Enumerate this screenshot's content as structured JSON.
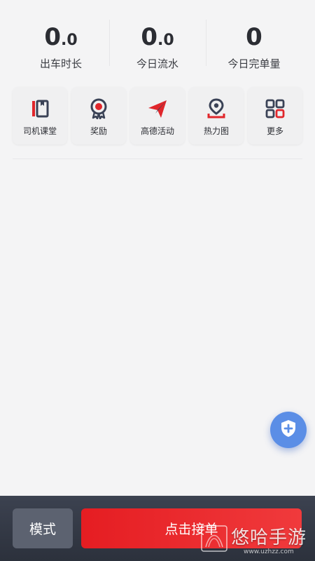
{
  "stats": [
    {
      "int": "0",
      "dec": ".0",
      "label": "出车时长"
    },
    {
      "int": "0",
      "dec": ".0",
      "label": "今日流水"
    },
    {
      "int": "0",
      "dec": "",
      "label": "今日完单量"
    }
  ],
  "tools": [
    {
      "label": "司机课堂",
      "icon": "book-icon"
    },
    {
      "label": "奖励",
      "icon": "award-icon"
    },
    {
      "label": "高德活动",
      "icon": "paper-plane-icon"
    },
    {
      "label": "热力图",
      "icon": "location-pin-icon"
    },
    {
      "label": "更多",
      "icon": "grid-icon"
    }
  ],
  "fab": {
    "icon": "shield-plus-icon"
  },
  "bottom_bar": {
    "mode_label": "模式",
    "accept_label": "点击接单"
  },
  "watermark": {
    "title": "悠哈手游",
    "site": "www.uzhzz.com"
  },
  "colors": {
    "accent_red": "#e51d22",
    "icon_dark": "#3a4256",
    "fab_blue": "#5b8ee6",
    "bar_dark": "#343946"
  }
}
